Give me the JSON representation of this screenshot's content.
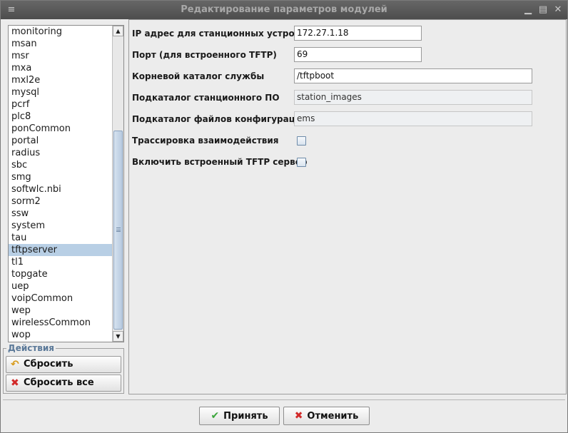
{
  "window": {
    "title": "Редактирование параметров модулей",
    "menu_icon": "menu-icon",
    "minimize_icon": "minimize-icon",
    "maximize_icon": "maximize-icon",
    "close_icon": "close-icon"
  },
  "modules": {
    "items": [
      "monitoring",
      "msan",
      "msr",
      "mxa",
      "mxl2e",
      "mysql",
      "pcrf",
      "plc8",
      "ponCommon",
      "portal",
      "radius",
      "sbc",
      "smg",
      "softwlc.nbi",
      "sorm2",
      "ssw",
      "system",
      "tau",
      "tftpserver",
      "tl1",
      "topgate",
      "uep",
      "voipCommon",
      "wep",
      "wirelessCommon",
      "wop"
    ],
    "selected": "tftpserver"
  },
  "actions": {
    "legend": "Действия",
    "reset_label": "Сбросить",
    "reset_all_label": "Сбросить все"
  },
  "params": {
    "ip_label": "IP адрес для станционных устройств",
    "ip_value": "172.27.1.18",
    "port_label": "Порт (для встроенного TFTP)",
    "port_value": "69",
    "root_label": "Корневой каталог службы",
    "root_value": "/tftpboot",
    "station_sw_label": "Подкаталог станционного ПО",
    "station_sw_value": "station_images",
    "config_label": "Подкаталог файлов конфигураций",
    "config_value": "ems",
    "trace_label": "Трассировка взаимодействия",
    "trace_checked": false,
    "tftp_enable_label": "Включить встроенный TFTP сервер",
    "tftp_enable_checked": false
  },
  "footer": {
    "ok_label": "Принять",
    "cancel_label": "Отменить"
  },
  "colors": {
    "selection": "#b8cfe5",
    "title_bar": "#5a5a5a",
    "legend_text": "#5a7898"
  }
}
